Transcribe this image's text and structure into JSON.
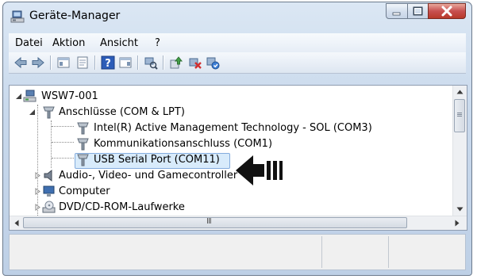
{
  "window": {
    "title": "Geräte-Manager",
    "accent": "#c9d9ec",
    "close_color": "#c75050"
  },
  "window_controls": [
    "minimize-icon",
    "maximize-icon",
    "close-icon"
  ],
  "menubar": {
    "items": [
      {
        "label": "Datei"
      },
      {
        "label": "Aktion"
      },
      {
        "label": "Ansicht"
      },
      {
        "label": "?"
      }
    ]
  },
  "toolbar": {
    "buttons": [
      "back-arrow-icon",
      "forward-arrow-icon",
      "show-hide-tree-icon",
      "properties-icon",
      "help-icon",
      "action-pane-icon",
      "scan-hardware-icon",
      "update-driver-icon",
      "uninstall-icon",
      "enable-device-icon"
    ]
  },
  "tree": {
    "root": "WSW7-001",
    "items": [
      {
        "label": "Anschlüsse (COM & LPT)",
        "expanded": true
      },
      {
        "label": "Intel(R) Active Management Technology - SOL (COM3)"
      },
      {
        "label": "Kommunikationsanschluss (COM1)"
      },
      {
        "label": "USB Serial Port (COM11)",
        "selected": true
      },
      {
        "label": "Audio-, Video- und Gamecontroller"
      },
      {
        "label": "Computer"
      },
      {
        "label": "DVD/CD-ROM-Laufwerke"
      }
    ],
    "hscroll_grip": "III",
    "selection_color": "#d8ebfb"
  },
  "annotation": {
    "arrow": "left-pointing-arrow-icon"
  }
}
